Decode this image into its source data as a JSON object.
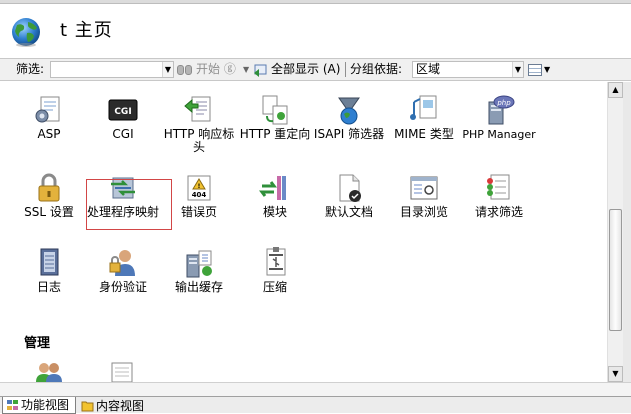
{
  "header": {
    "title": "t  主页"
  },
  "filter": {
    "label": "筛选:",
    "input_value": "",
    "start_label": "开始 ⓖ",
    "show_all_label": "全部显示 (A)",
    "group_label": "分组依据:",
    "group_value": "区域"
  },
  "features": {
    "row1": [
      {
        "label": "ASP",
        "icon": "asp-icon"
      },
      {
        "label": "CGI",
        "icon": "cgi-icon"
      },
      {
        "label": "HTTP 响应标头",
        "icon": "http-response-headers-icon"
      },
      {
        "label": "HTTP 重定向",
        "icon": "http-redirect-icon"
      },
      {
        "label": "ISAPI 筛选器",
        "icon": "isapi-filters-icon"
      },
      {
        "label": "MIME 类型",
        "icon": "mime-types-icon"
      },
      {
        "label": "PHP Manager",
        "icon": "php-manager-icon"
      }
    ],
    "row2": [
      {
        "label": "SSL 设置",
        "icon": "ssl-settings-icon"
      },
      {
        "label": "处理程序映射",
        "icon": "handler-mappings-icon"
      },
      {
        "label": "错误页",
        "icon": "error-pages-icon"
      },
      {
        "label": "模块",
        "icon": "modules-icon"
      },
      {
        "label": "默认文档",
        "icon": "default-document-icon"
      },
      {
        "label": "目录浏览",
        "icon": "directory-browsing-icon"
      },
      {
        "label": "请求筛选",
        "icon": "request-filtering-icon"
      }
    ],
    "row3": [
      {
        "label": "日志",
        "icon": "logging-icon"
      },
      {
        "label": "身份验证",
        "icon": "authentication-icon"
      },
      {
        "label": "输出缓存",
        "icon": "output-caching-icon"
      },
      {
        "label": "压缩",
        "icon": "compression-icon"
      }
    ]
  },
  "section_management": "管理",
  "tabs": [
    {
      "label": "功能视图",
      "active": true
    },
    {
      "label": "内容视图",
      "active": false
    }
  ],
  "colors": {
    "selection_border": "#d24646",
    "toolbar_bg": "#f0f0f0"
  }
}
